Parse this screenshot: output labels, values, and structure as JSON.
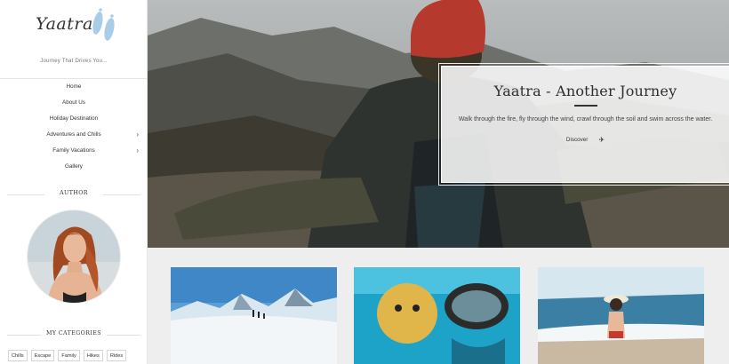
{
  "site": {
    "logo_text": "Yaatra",
    "tagline": "Journey That Drives You..."
  },
  "nav": {
    "items": [
      {
        "label": "Home",
        "has_children": false
      },
      {
        "label": "About Us",
        "has_children": false
      },
      {
        "label": "Holiday Destination",
        "has_children": false
      },
      {
        "label": "Adventures and Chills",
        "has_children": true
      },
      {
        "label": "Family Vacations",
        "has_children": true
      },
      {
        "label": "Gallery",
        "has_children": false
      }
    ]
  },
  "author": {
    "heading": "AUTHOR"
  },
  "categories": {
    "heading": "MY CATEGORIES",
    "tags": [
      "Chills",
      "Escape",
      "Family",
      "Hikes",
      "Rides"
    ]
  },
  "hero": {
    "title": "Yaatra - Another Journey",
    "text": "Walk through the fire, fly through the wind, crawl through the soil and swim across the water.",
    "link_label": "Discover",
    "link_icon": "paper-plane-icon"
  },
  "cards": [
    {
      "image": "snowy-mountain-hikers"
    },
    {
      "image": "diver-with-pufferfish"
    },
    {
      "image": "woman-on-beach"
    }
  ],
  "colors": {
    "accent": "#3a86c8",
    "logo_feet": "#a8cde8"
  }
}
